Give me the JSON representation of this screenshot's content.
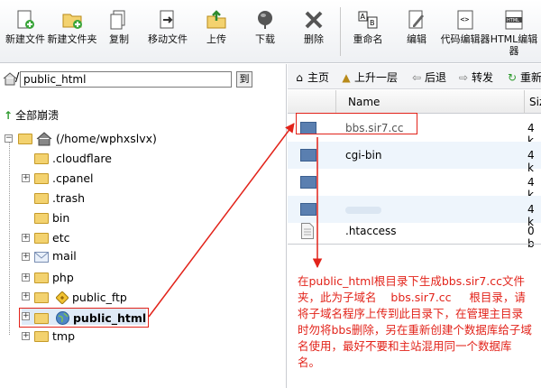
{
  "toolbar": {
    "buttons": [
      {
        "label": "新建文件",
        "icon": "new-file-icon"
      },
      {
        "label": "新建文件夹",
        "icon": "new-folder-icon"
      },
      {
        "label": "复制",
        "icon": "copy-icon"
      },
      {
        "label": "移动文件",
        "icon": "move-icon"
      },
      {
        "label": "上传",
        "icon": "upload-icon"
      },
      {
        "label": "下载",
        "icon": "download-icon"
      },
      {
        "label": "删除",
        "icon": "delete-icon"
      },
      {
        "label": "重命名",
        "icon": "rename-icon"
      },
      {
        "label": "编辑",
        "icon": "edit-icon"
      },
      {
        "label": "代码编辑器",
        "icon": "code-editor-icon"
      },
      {
        "label": "HTML编辑器",
        "icon": "html-editor-icon"
      }
    ]
  },
  "left": {
    "path_value": "public_html",
    "go_label": "到",
    "collapse_label": "全部崩溃",
    "root_label": "(/home/wphxslvx)",
    "tree": [
      {
        "label": ".cloudflare",
        "expandable": false
      },
      {
        "label": ".cpanel",
        "expandable": true
      },
      {
        "label": ".trash",
        "expandable": false
      },
      {
        "label": "bin",
        "expandable": false
      },
      {
        "label": "etc",
        "expandable": true
      },
      {
        "label": "mail",
        "expandable": true
      },
      {
        "label": "php",
        "expandable": true
      },
      {
        "label": "public_ftp",
        "expandable": true
      },
      {
        "label": "public_html",
        "expandable": true
      },
      {
        "label": "tmp",
        "expandable": true
      }
    ]
  },
  "right": {
    "nav": [
      {
        "label": "主页",
        "icon": "home-icon"
      },
      {
        "label": "上升一层",
        "icon": "up-level-icon"
      },
      {
        "label": "后退",
        "icon": "back-icon"
      },
      {
        "label": "转发",
        "icon": "forward-icon"
      },
      {
        "label": "重新",
        "icon": "reload-icon"
      }
    ],
    "columns": {
      "name": "Name",
      "size": "Siz"
    },
    "files": [
      {
        "name": "bbs.sir7.cc",
        "size": "4 k",
        "type": "folder"
      },
      {
        "name": "cgi-bin",
        "size": "4 k",
        "type": "folder"
      },
      {
        "name": "",
        "size": "4 k",
        "type": "folder"
      },
      {
        "name": "",
        "size": "4 k",
        "type": "folder"
      },
      {
        "name": ".htaccess",
        "size": "0 b",
        "type": "file"
      }
    ],
    "annotation": "在public_html根目录下生成bbs.sir7.cc文件夹，此为子域名    bbs.sir7.cc     根目录，请将子域名程序上传到此目录下，在管理主目录时勿将bbs删除，另在重新创建个数据库给子域名使用，最好不要和主站混用同一个数据库名。"
  }
}
